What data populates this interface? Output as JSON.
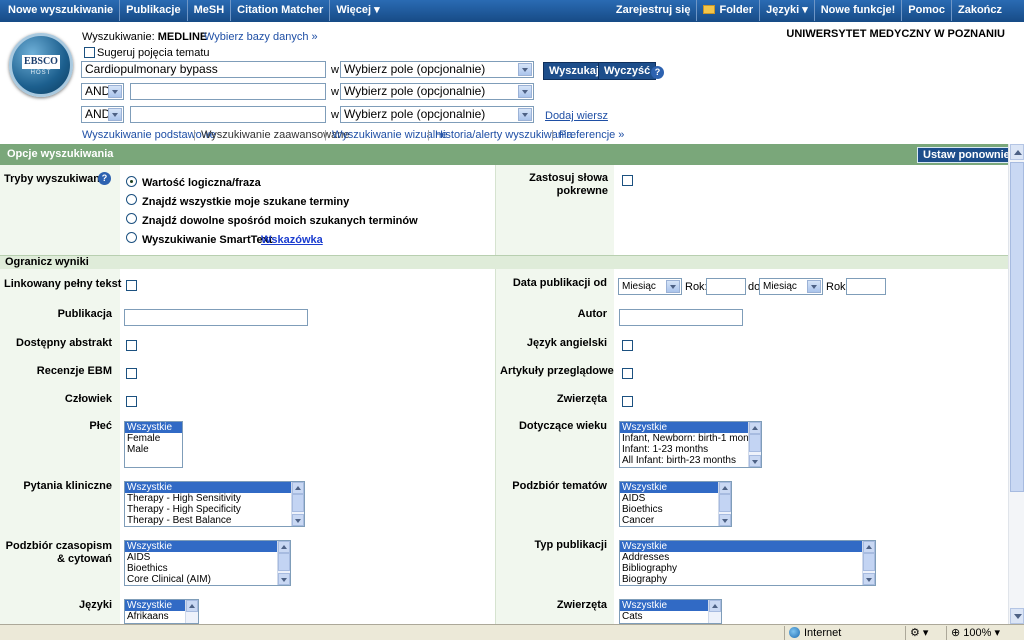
{
  "topnav": {
    "left": [
      "Nowe wyszukiwanie",
      "Publikacje",
      "MeSH",
      "Citation Matcher",
      "Więcej"
    ],
    "right": [
      "Zarejestruj się",
      "Folder",
      "Języki",
      "Nowe funkcje!",
      "Pomoc",
      "Zakończ"
    ]
  },
  "header": {
    "logo_text": "EBSCO",
    "logo_sub": "HOST",
    "search_label": "Wyszukiwanie:",
    "database": "MEDLINE",
    "choose_db": "Wybierz bazy danych »",
    "suggest": "Sugeruj pojęcia tematu",
    "institution": "UNIWERSYTET MEDYCZNY W POZNANIU",
    "rows": [
      {
        "bool": "",
        "value": "Cardiopulmonary bypass",
        "field": "Wybierz pole (opcjonalnie)"
      },
      {
        "bool": "AND",
        "value": "",
        "field": "Wybierz pole (opcjonalnie)"
      },
      {
        "bool": "AND",
        "value": "",
        "field": "Wybierz pole (opcjonalnie)"
      }
    ],
    "in_label": "w",
    "search_btn": "Wyszukaj",
    "clear_btn": "Wyczyść",
    "add_row": "Dodaj wiersz",
    "links": [
      "Wyszukiwanie podstawowe",
      "Wyszukiwanie zaawansowane",
      "Wyszukiwanie wizualne",
      "Historia/alerty wyszukiwania",
      "Preferencje »"
    ]
  },
  "options": {
    "title": "Opcje wyszukiwania",
    "reset_btn": "Ustaw ponownie",
    "modes_label": "Tryby wyszukiwania",
    "modes": [
      "Wartość logiczna/fraza",
      "Znajdź wszystkie moje szukane terminy",
      "Znajdź dowolne spośród moich szukanych terminów",
      "Wyszukiwanie SmartText"
    ],
    "tips": "Wskazówka",
    "related_label": "Zastosuj słowa pokrewne"
  },
  "limits": {
    "title": "Ogranicz wyniki",
    "fulltext": "Linkowany pełny tekst",
    "pubdate": "Data publikacji od",
    "month": "Miesiąc",
    "year": "Rok:",
    "to": "do",
    "publication": "Publikacja",
    "author": "Autor",
    "abstract": "Dostępny abstrakt",
    "english": "Język angielski",
    "ebm": "Recenzje EBM",
    "review": "Artykuły przeglądowe",
    "human": "Człowiek",
    "animals": "Zwierzęta",
    "sex": "Płeć",
    "sex_opts": [
      "Wszystkie",
      "Female",
      "Male"
    ],
    "age": "Dotyczące wieku",
    "age_opts": [
      "Wszystkie",
      "Infant, Newborn: birth-1 month",
      "Infant: 1-23 months",
      "All Infant: birth-23 months"
    ],
    "clinical": "Pytania kliniczne",
    "clinical_opts": [
      "Wszystkie",
      "Therapy - High Sensitivity",
      "Therapy - High Specificity",
      "Therapy - Best Balance"
    ],
    "subject": "Podzbiór tematów",
    "subject_opts": [
      "Wszystkie",
      "AIDS",
      "Bioethics",
      "Cancer"
    ],
    "journal": "Podzbiór czasopism & cytowań",
    "journal_opts": [
      "Wszystkie",
      "AIDS",
      "Bioethics",
      "Core Clinical (AIM)"
    ],
    "pubtype": "Typ publikacji",
    "pubtype_opts": [
      "Wszystkie",
      "Addresses",
      "Bibliography",
      "Biography"
    ],
    "languages": "Języki",
    "lang_opts": [
      "Wszystkie",
      "Afrikaans"
    ],
    "animals2": "Zwierzęta",
    "animal_opts": [
      "Wszystkie",
      "Cats"
    ]
  },
  "status": {
    "zone": "Internet",
    "zoom": "100%"
  }
}
